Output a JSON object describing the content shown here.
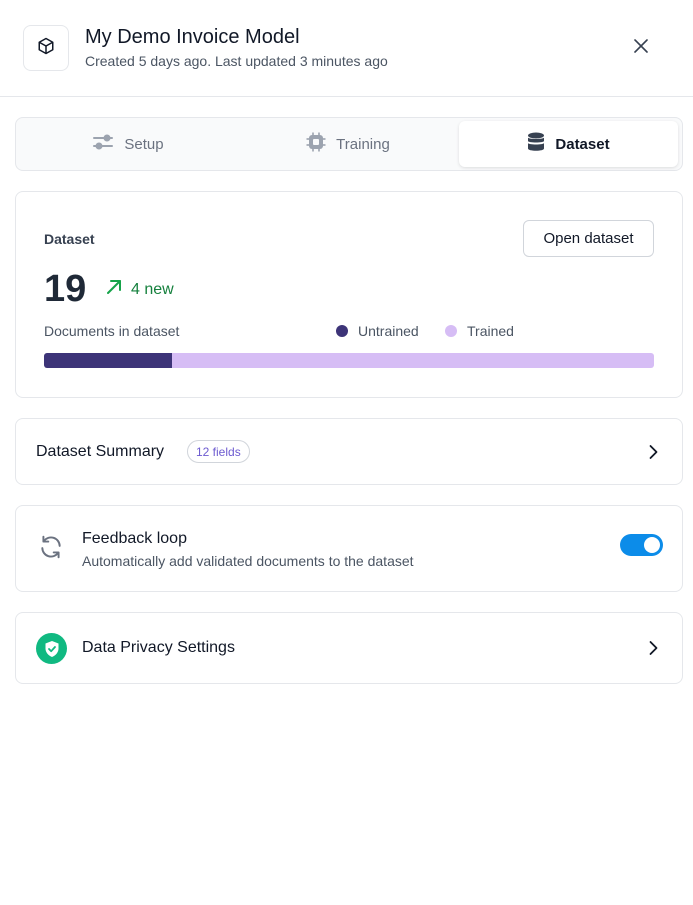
{
  "header": {
    "title": "My Demo Invoice Model",
    "subtitle": "Created 5 days ago. Last updated 3 minutes ago",
    "logo_icon": "cube-icon",
    "close_icon": "close-icon"
  },
  "tabs": [
    {
      "label": "Setup",
      "icon": "sliders-icon",
      "active": false
    },
    {
      "label": "Training",
      "icon": "chip-icon",
      "active": false
    },
    {
      "label": "Dataset",
      "icon": "database-icon",
      "active": true
    }
  ],
  "dataset": {
    "label": "Dataset",
    "open_button": "Open dataset",
    "count": "19",
    "new_label": "4 new",
    "new_icon": "arrow-up-right-icon",
    "docs_label": "Documents in dataset",
    "legend": {
      "untrained": "Untrained",
      "trained": "Trained"
    },
    "untrained_fraction": 0.21,
    "colors": {
      "untrained": "#3d3478",
      "trained": "#d6bdf5",
      "new": "#15803d"
    }
  },
  "summary": {
    "label": "Dataset Summary",
    "badge": "12 fields"
  },
  "feedback": {
    "title": "Feedback loop",
    "description": "Automatically add validated documents to the dataset",
    "enabled": true,
    "icon": "refresh-icon",
    "toggle_color": "#0c8ce9"
  },
  "privacy": {
    "label": "Data Privacy Settings",
    "icon": "shield-check-icon",
    "icon_color": "#10b981"
  }
}
